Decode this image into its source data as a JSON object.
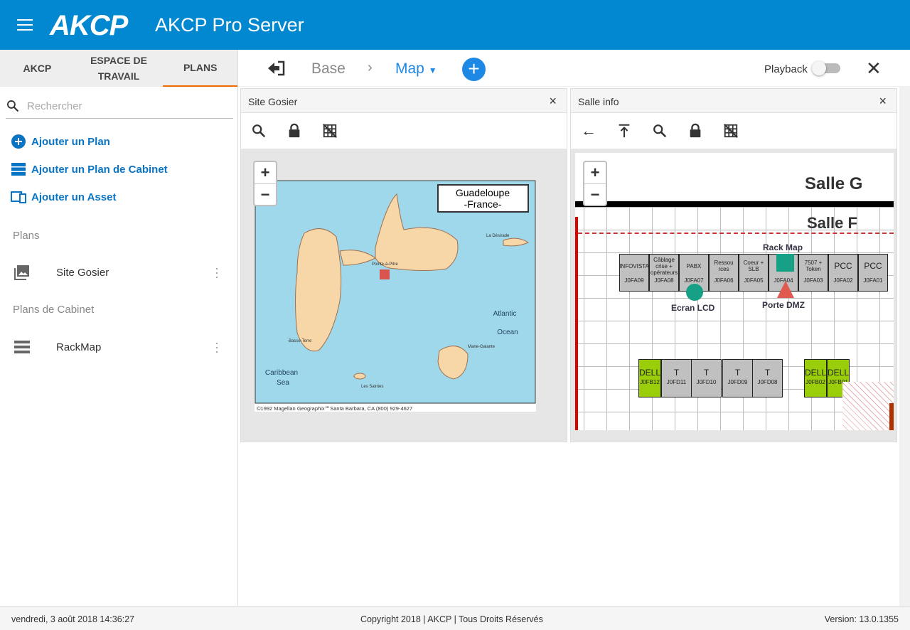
{
  "header": {
    "logo": "AKCP",
    "title": "AKCP Pro Server"
  },
  "sidebar": {
    "tabs": [
      {
        "label": "AKCP"
      },
      {
        "label": "ESPACE DE TRAVAIL"
      },
      {
        "label": "PLANS"
      }
    ],
    "search_placeholder": "Rechercher",
    "actions": [
      {
        "label": "Ajouter un Plan"
      },
      {
        "label": "Ajouter un Plan de Cabinet"
      },
      {
        "label": "Ajouter un Asset"
      }
    ],
    "plans_heading": "Plans",
    "plans": [
      {
        "label": "Site Gosier"
      }
    ],
    "cabinet_heading": "Plans de Cabinet",
    "cabinets": [
      {
        "label": "RackMap"
      }
    ]
  },
  "toolbar": {
    "breadcrumb": [
      "Base",
      "Map"
    ],
    "playback_label": "Playback",
    "playback_on": false
  },
  "panels": [
    {
      "title": "Site Gosier",
      "map": {
        "title_line1": "Guadeloupe",
        "title_line2": "-France-",
        "labels": [
          "Atlantic",
          "Ocean",
          "Caribbean",
          "Sea",
          "Basse-Terre",
          "Pointe-à-Pitre",
          "Marie-Galante",
          "La Désirade",
          "Les Saintes"
        ],
        "copyright": "©1992 Magellan Geographix℠Santa Barbara, CA (800) 929-4627"
      }
    },
    {
      "title": "Salle info",
      "plan": {
        "salle_g": "Salle G",
        "salle_f": "Salle F",
        "top_racks": [
          {
            "name": "INFOVISTA",
            "id": "J0FA09"
          },
          {
            "name": "Câblage crise + opérateurs",
            "id": "J0FA08"
          },
          {
            "name": "PABX",
            "id": "J0FA07"
          },
          {
            "name": "Ressou rces",
            "id": "J0FA06"
          },
          {
            "name": "Coeur + SLB",
            "id": "J0FA05"
          },
          {
            "name": "",
            "id": "J0FA04"
          },
          {
            "name": "7507 + Token",
            "id": "J0FA03"
          },
          {
            "name": "PCC",
            "id": "J0FA02"
          },
          {
            "name": "PCC",
            "id": "J0FA01"
          }
        ],
        "bottom_racks": [
          {
            "name": "DELL",
            "id": "J0FB12",
            "color": "#9acd0a"
          },
          {
            "name": "T",
            "id": "J0FD11"
          },
          {
            "name": "T",
            "id": "J0FD10"
          },
          {
            "name": "T",
            "id": "J0FD09"
          },
          {
            "name": "T",
            "id": "J0FD08"
          },
          {
            "name": "DELL",
            "id": "J0FB02",
            "color": "#9acd0a"
          },
          {
            "name": "DELL",
            "id": "J0FB01",
            "color": "#9acd0a"
          }
        ],
        "markers": {
          "rack_map": "Rack Map",
          "ecran": "Ecran LCD",
          "porte": "Porte DMZ"
        },
        "marker_colors": {
          "rack_map": "#16a085",
          "ecran": "#16a085",
          "porte": "#e05a4f"
        }
      }
    }
  ],
  "footer": {
    "datetime": "vendredi, 3 août 2018 14:36:27",
    "copyright": "Copyright 2018 | AKCP | Tous Droits Réservés",
    "version": "Version: 13.0.1355"
  }
}
